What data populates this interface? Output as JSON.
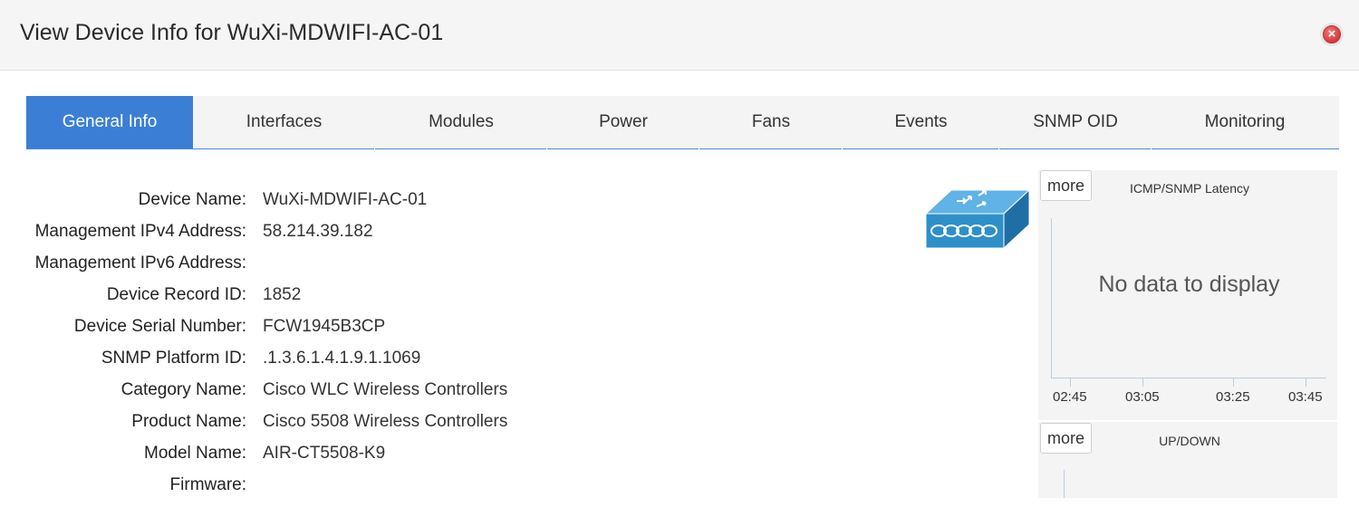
{
  "modal": {
    "title": "View Device Info for WuXi-MDWIFI-AC-01",
    "close_symbol": "×"
  },
  "tabs": [
    {
      "label": "General Info",
      "active": true
    },
    {
      "label": "Interfaces"
    },
    {
      "label": "Modules"
    },
    {
      "label": "Power"
    },
    {
      "label": "Fans"
    },
    {
      "label": "Events"
    },
    {
      "label": "SNMP OID"
    },
    {
      "label": "Monitoring"
    }
  ],
  "general_info": [
    {
      "label": "Device Name:",
      "value": "WuXi-MDWIFI-AC-01"
    },
    {
      "label": "Management IPv4 Address:",
      "value": "58.214.39.182"
    },
    {
      "label": "Management IPv6 Address:",
      "value": ""
    },
    {
      "label": "Device Record ID:",
      "value": "1852"
    },
    {
      "label": "Device Serial Number:",
      "value": "FCW1945B3CP"
    },
    {
      "label": "SNMP Platform ID:",
      "value": ".1.3.6.1.4.1.9.1.1069"
    },
    {
      "label": "Category Name:",
      "value": "Cisco WLC Wireless Controllers"
    },
    {
      "label": "Product Name:",
      "value": "Cisco 5508 Wireless Controllers"
    },
    {
      "label": "Model Name:",
      "value": "AIR-CT5508-K9"
    },
    {
      "label": "Firmware:",
      "value": ""
    }
  ],
  "device_icon": "wireless-controller-icon",
  "latency_panel": {
    "more_label": "more",
    "title": "ICMP/SNMP Latency",
    "empty_text": "No data to display",
    "x_labels": [
      "02:45",
      "03:05",
      "03:25",
      "03:45"
    ]
  },
  "updown_panel": {
    "more_label": "more",
    "title": "UP/DOWN"
  },
  "colors": {
    "accent": "#3a7fd5",
    "close": "#d63a3a",
    "device_blue": "#2f8fc9"
  }
}
